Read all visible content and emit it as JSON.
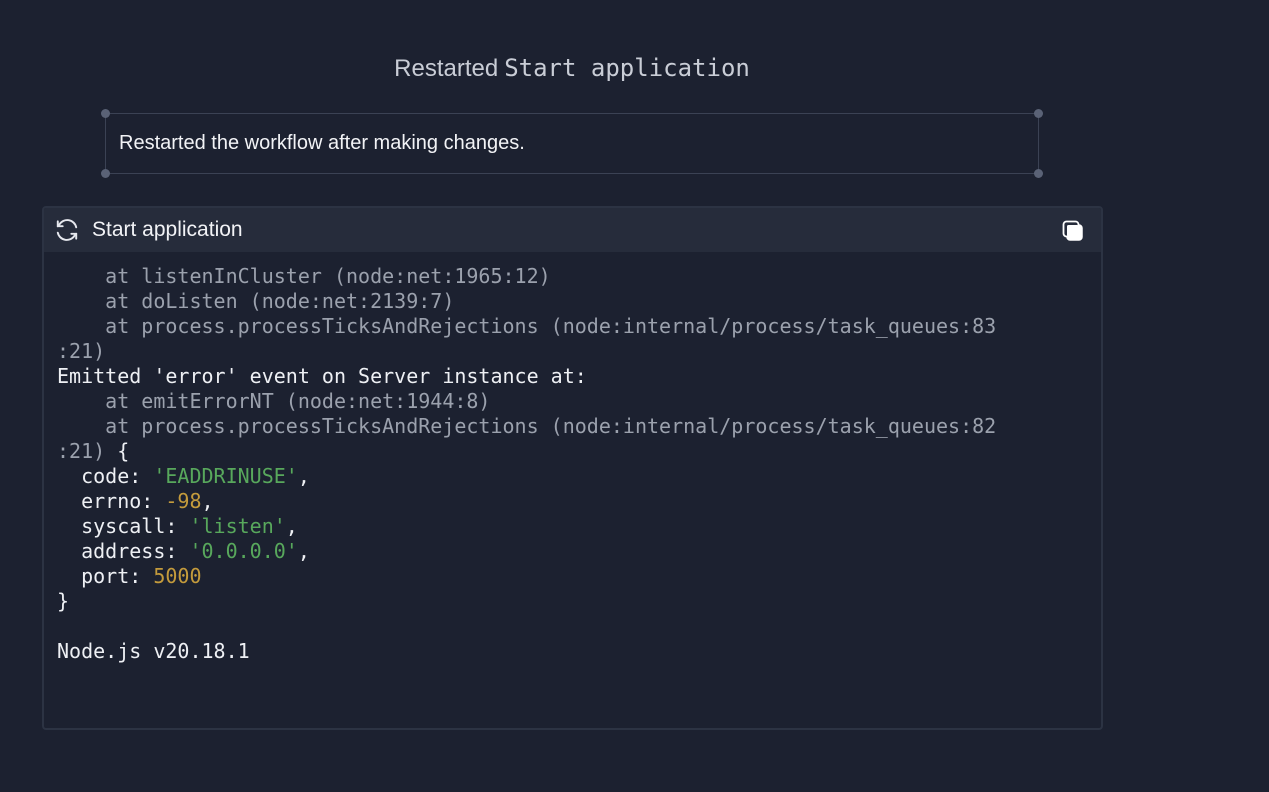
{
  "header": {
    "action_label": "Restarted",
    "workflow_name": "Start application"
  },
  "note": {
    "text": "Restarted the workflow after making changes."
  },
  "panel": {
    "title": "Start application",
    "icons": {
      "refresh": "refresh-icon",
      "copy": "copy-icon"
    }
  },
  "console": {
    "lines": {
      "l1": "    at listenInCluster (node:net:1965:12)",
      "l2": "    at doListen (node:net:2139:7)",
      "l3": "    at process.processTicksAndRejections (node:internal/process/task_queues:83",
      "l4": ":21)",
      "l5": "Emitted 'error' event on Server instance at:",
      "l6": "    at emitErrorNT (node:net:1944:8)",
      "l7": "    at process.processTicksAndRejections (node:internal/process/task_queues:82",
      "l8a": ":21)",
      "l8b": " {",
      "code_key": "  code: ",
      "code_val": "'EADDRINUSE'",
      "errno_key": "  errno: ",
      "errno_val": "-98",
      "syscall_key": "  syscall: ",
      "syscall_val": "'listen'",
      "address_key": "  address: ",
      "address_val": "'0.0.0.0'",
      "port_key": "  port: ",
      "port_val": "5000",
      "close": "}",
      "version": "Node.js v20.18.1"
    }
  },
  "colors": {
    "background": "#1c2130",
    "header_bg": "#262c3b",
    "string": "#58a85c",
    "number": "#c49b3c",
    "dim": "#9ba1ad"
  }
}
